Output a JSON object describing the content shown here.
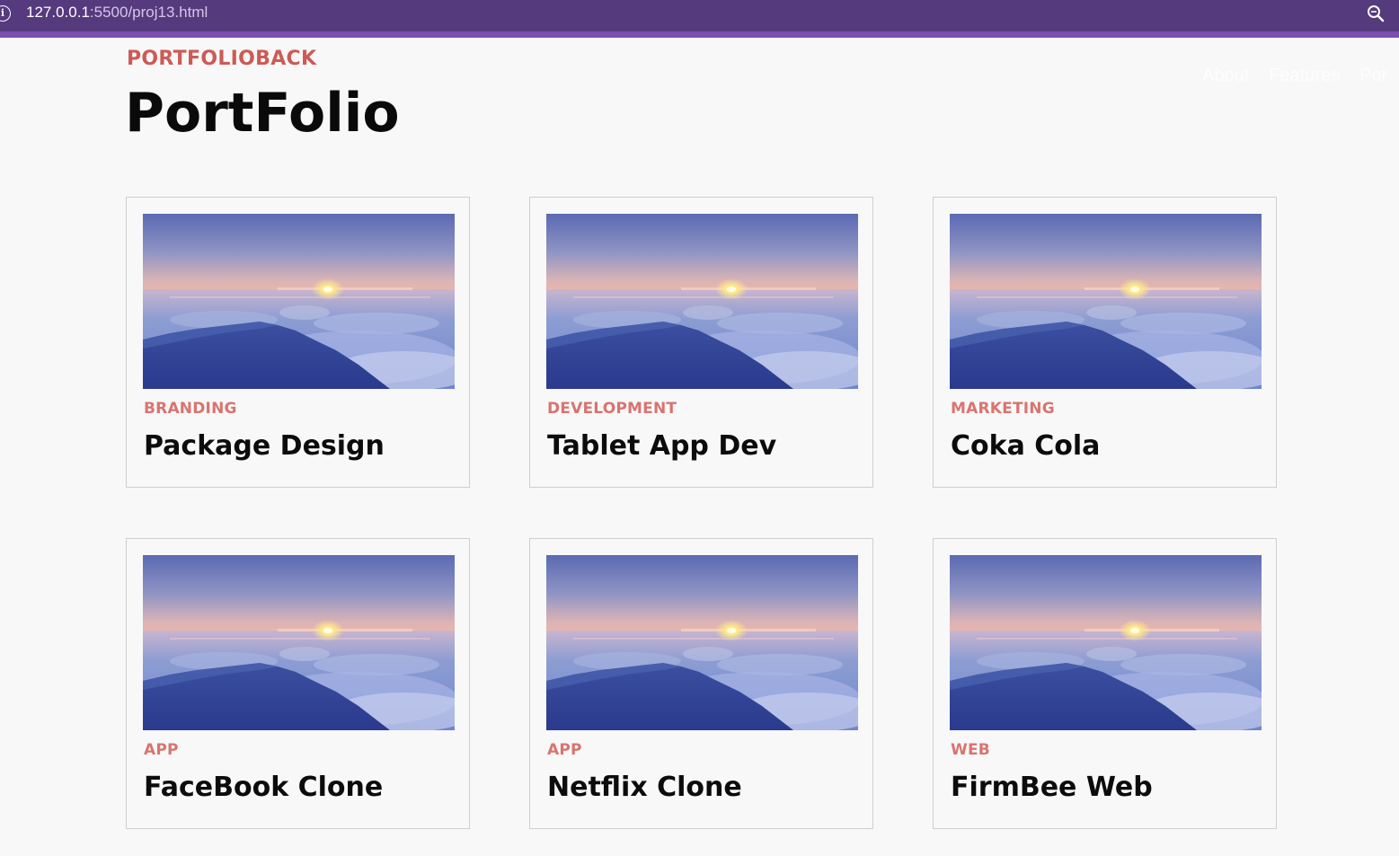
{
  "browser": {
    "url_host": "127.0.0.1",
    "url_path": ":5500/proj13.html",
    "info_icon": "info-icon",
    "zoom_icon": "zoom-icon"
  },
  "header": {
    "brand": "PORTFOLIOBACK",
    "title": "PortFolio"
  },
  "nav": {
    "items": [
      "About",
      "Features",
      "Por"
    ]
  },
  "cards": [
    {
      "category": "BRANDING",
      "title": "Package Design"
    },
    {
      "category": "DEVELOPMENT",
      "title": "Tablet App Dev"
    },
    {
      "category": "MARKETING",
      "title": "Coka Cola"
    },
    {
      "category": "APP",
      "title": "FaceBook Clone"
    },
    {
      "category": "APP",
      "title": "Netflix Clone"
    },
    {
      "category": "WEB",
      "title": "FirmBee Web"
    }
  ],
  "colors": {
    "addressbar": "#563a7e",
    "brand": "#cd5a56",
    "category": "#d9746f"
  }
}
